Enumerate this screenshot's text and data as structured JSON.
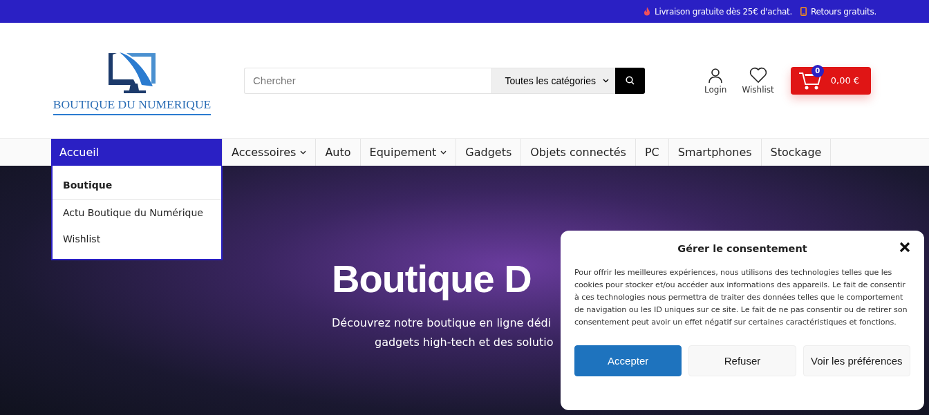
{
  "top_bar": {
    "items": [
      {
        "kind": "flame",
        "text": "Livraison gratuite dès 25€ d'achat."
      },
      {
        "kind": "phone",
        "text": "Retours gratuits."
      }
    ]
  },
  "header": {
    "logo_text": "BOUTIQUE DU NUMERIQUE",
    "search": {
      "placeholder": "Chercher",
      "category": "Toutes les catégories"
    },
    "actions": [
      {
        "kind": "user",
        "label": "Login"
      },
      {
        "kind": "heart",
        "label": "Wishlist"
      }
    ],
    "cart": {
      "count": "0",
      "total": "0,00 €"
    }
  },
  "nav": {
    "items": [
      {
        "label": "Accueil",
        "selected": true,
        "caret": false,
        "expanded": true
      },
      {
        "label": "Accessoires",
        "selected": false,
        "caret": true,
        "expanded": false
      },
      {
        "label": "Auto",
        "selected": false,
        "caret": false,
        "expanded": false
      },
      {
        "label": "Equipement",
        "selected": false,
        "caret": true,
        "expanded": false
      },
      {
        "label": "Gadgets",
        "selected": false,
        "caret": false,
        "expanded": false
      },
      {
        "label": "Objets connectés",
        "selected": false,
        "caret": false,
        "expanded": false
      },
      {
        "label": "PC",
        "selected": false,
        "caret": false,
        "expanded": false
      },
      {
        "label": "Smartphones",
        "selected": false,
        "caret": false,
        "expanded": false
      },
      {
        "label": "Stockage",
        "selected": false,
        "caret": false,
        "expanded": false
      }
    ],
    "dropdown": [
      {
        "label": "Boutique",
        "selected": true
      },
      {
        "label": "Actu Boutique du Numérique",
        "selected": false
      },
      {
        "label": "Wishlist",
        "selected": false
      }
    ]
  },
  "hero": {
    "title": "Boutique D",
    "subtitle_lines": [
      "Découvrez notre boutique en ligne dédi",
      "gadgets high-tech et des solutio"
    ]
  },
  "consent": {
    "title": "Gérer le consentement",
    "text": "Pour offrir les meilleures expériences, nous utilisons des technologies telles que les cookies pour stocker et/ou accéder aux informations des appareils. Le fait de consentir à ces technologies nous permettra de traiter des données telles que le comportement de navigation ou les ID uniques sur ce site. Le fait de ne pas consentir ou de retirer son consentement peut avoir un effet négatif sur certaines caractéristiques et fonctions.",
    "buttons": [
      {
        "label": "Accepter",
        "primary": true
      },
      {
        "label": "Refuser",
        "primary": false
      },
      {
        "label": "Voir les préférences",
        "primary": false
      }
    ]
  }
}
